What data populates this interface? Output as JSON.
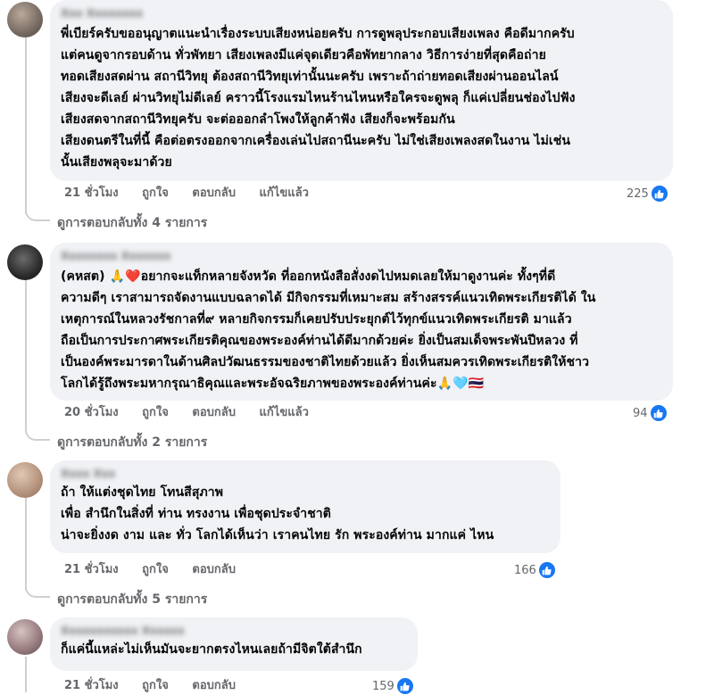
{
  "comments": [
    {
      "author": "Xxx Xxxxxxxx",
      "text": "พี่เบียร์ครับขออนุญาตแนะนำเรื่องระบบเสียงหน่อยครับ การดูพลุประกอบเสียงเพลง คือดีมากครับ\nแต่คนดูจากรอบด้าน ทั่วพัทยา เสียงเพลงมีแค่จุดเดียวคือพัทยากลาง วิธีการง่ายที่สุดคือถ่าย\nทอดเสียงสดผ่าน สถานีวิทยุ ต้องสถานีวิทยุเท่านั้นนะครับ เพราะถ้าถ่ายทอดเสียงผ่านออนไลน์\nเสียงจะดีเลย์ ผ่านวิทยุไม่ดีเลย์ คราวนี้โรงแรมไหนร้านไหนหรือใครจะดูพลุ ก็แค่เปลี่ยนช่องไปฟัง\nเสียงสดจากสถานีวิทยุครับ จะต่อออกลำโพงให้ลูกค้าฟัง เสียงก็จะพร้อมกัน\nเสียงดนตรีในที่นี้ คือต่อตรงออกจากเครื่องเล่นไปสถานีนะครับ ไม่ใช่เสียงเพลงสดในงาน ไม่เช่น\nนั้นเสียงพลุจะมาด้วย",
      "time": "21 ชั่วโมง",
      "like": "ถูกใจ",
      "reply": "ตอบกลับ",
      "edited": "แก้ไขแล้ว",
      "reactions": "225",
      "replies": "ดูการตอบกลับทั้ง 4 รายการ"
    },
    {
      "author": "Xxxxxxxx Xxxxxxx",
      "text_lead": "(คหสต)",
      "lead_emoji": "🙏❤️",
      "text": "อยากจะแท็กหลายจังหวัด ที่ออกหนังสือสั่งงดไปหมดเลยให้มาดูงานค่ะ ทั้งๆที่ดี\nความดีๆ เราสามารถจัดงานแบบฉลาดได้ มีกิจกรรมที่เหมาะสม สร้างสรรค์แนวเทิดพระเกียรติได้ ใน\nเหตุการณ์ในหลวงรัชกาลที่๙ หลายกิจกรรมก็เคยปรับประยุกต์ไว้ทุกข์แนวเทิดพระเกียรติ มาแล้ว\nถือเป็นการประกาศพระเกียรติคุณของพระองค์ท่านได้ดีมากด้วยค่ะ ยิ่งเป็นสมเด็จพระพันปีหลวง ที่\nเป็นองค์พระมารดาในด้านศิลปวัฒนธรรมของชาติไทยด้วยแล้ว ยิ่งเห็นสมควรเทิดพระเกียรติให้ชาว\nโลกได้รู้ถึงพระมหากรุณาธิคุณและพระอัจฉริยภาพของพระองค์ท่านค่ะ",
      "trail_emoji": "🙏🩵🇹🇭",
      "time": "20 ชั่วโมง",
      "like": "ถูกใจ",
      "reply": "ตอบกลับ",
      "edited": "แก้ไขแล้ว",
      "reactions": "94",
      "replies": "ดูการตอบกลับทั้ง 2 รายการ"
    },
    {
      "author": "Xxxx Xxx",
      "text": "ถ้า ให้แต่งชุดไทย โทนสีสุภาพ\nเพื่อ สำนึกในสิ่งที่ ท่าน ทรงงาน เพื่อชุดประจำชาติ\nน่าจะยิ่งงด งาม และ ทั่ว โลกได้เห็นว่า เราคนไทย รัก พระองค์ท่าน มากแค่ ไหน",
      "time": "21 ชั่วโมง",
      "like": "ถูกใจ",
      "reply": "ตอบกลับ",
      "reactions": "166",
      "replies": "ดูการตอบกลับทั้ง 5 รายการ"
    },
    {
      "author": "Xxxxxxxxxxx Xxxxxx",
      "text": "ก็แค่นี้แหล่ะไม่เห็นมันจะยากตรงไหนเลยถ้ามีจิตใต้สำนึก",
      "time": "21 ชั่วโมง",
      "like": "ถูกใจ",
      "reply": "ตอบกลับ",
      "reactions": "159"
    }
  ],
  "colors": {
    "bubble": "#f0f2f5",
    "meta": "#65676b",
    "like_blue": "#1877f2"
  }
}
